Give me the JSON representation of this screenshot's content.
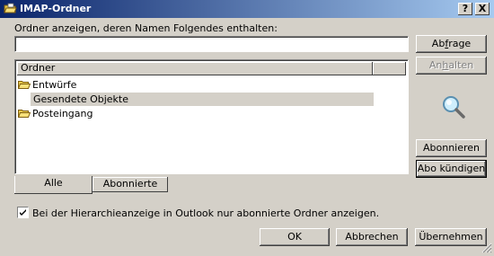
{
  "window": {
    "title": "IMAP-Ordner",
    "help_label": "?",
    "close_label": "X"
  },
  "filter": {
    "label": "Ordner anzeigen, deren Namen Folgendes enthalten:",
    "value": ""
  },
  "buttons": {
    "query_pre": "Ab",
    "query_ul": "f",
    "query_post": "rage",
    "stop_pre": "An",
    "stop_ul": "h",
    "stop_post": "alten",
    "subscribe": "Abonnieren",
    "unsubscribe": "Abo kündigen",
    "ok": "OK",
    "cancel": "Abbrechen",
    "apply": "Übernehmen"
  },
  "folder_list": {
    "column_header": "Ordner",
    "items": [
      {
        "label": "Entwürfe",
        "icon": "open-folder-icon",
        "selected": false
      },
      {
        "label": "Gesendete Objekte",
        "icon": "none",
        "selected": true
      },
      {
        "label": "Posteingang",
        "icon": "open-folder-icon",
        "selected": false
      }
    ]
  },
  "tabs": [
    {
      "label": "Alle",
      "active": true
    },
    {
      "label": "Abonnierte",
      "active": false
    }
  ],
  "option": {
    "checked": true,
    "label": "Bei der Hierarchieanzeige in Outlook nur abonnierte Ordner anzeigen."
  },
  "colors": {
    "titlebar_start": "#0a246a",
    "titlebar_end": "#a6caf0",
    "dialog_face": "#d4d0c8",
    "disabled_text": "#808080"
  }
}
